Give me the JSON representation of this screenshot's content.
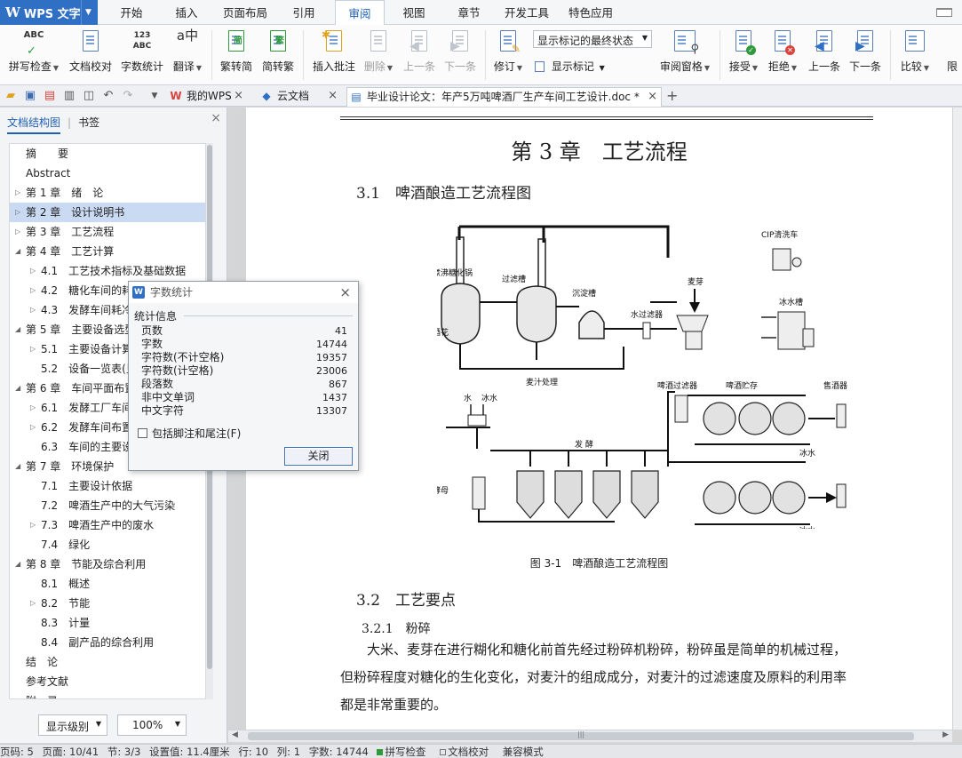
{
  "app": {
    "name": "WPS 文字"
  },
  "menu": [
    "开始",
    "插入",
    "页面布局",
    "引用",
    "审阅",
    "视图",
    "章节",
    "开发工具",
    "特色应用"
  ],
  "menu_active": "审阅",
  "ribbon": {
    "spell": "拼写检查",
    "proofread": "文档校对",
    "wordcount": "字数统计",
    "translate": "翻译",
    "trad2simp": "繁转简",
    "simp2trad": "简转繁",
    "insert_comment": "插入批注",
    "delete": "删除",
    "prev": "上一条",
    "next": "下一条",
    "revise": "修订",
    "track_state": "显示标记的最终状态",
    "show_marks": "显示标记",
    "review_pane": "审阅窗格",
    "accept": "接受",
    "reject": "拒绝",
    "prev2": "上一条",
    "next2": "下一条",
    "compare": "比较",
    "restrict": "限"
  },
  "tabs": {
    "mywps": "我的WPS",
    "cloud": "云文档",
    "doc": "毕业设计论文：年产5万吨啤酒厂生产车间工艺设计.doc *"
  },
  "panel": {
    "tab_outline": "文档结构图",
    "tab_bookmark": "书签",
    "level_select": "显示级别",
    "zoom_select": "100%"
  },
  "outline": [
    {
      "text": "摘　　要",
      "level": 0,
      "arrow": ""
    },
    {
      "text": "Abstract",
      "level": 0,
      "arrow": ""
    },
    {
      "text": "第 1 章　绪　论",
      "level": 0,
      "arrow": "▷"
    },
    {
      "text": "第 2 章　设计说明书",
      "level": 0,
      "arrow": "▷",
      "selected": true
    },
    {
      "text": "第 3 章　工艺流程",
      "level": 0,
      "arrow": "▷"
    },
    {
      "text": "第 4 章　工艺计算",
      "level": 0,
      "arrow": "◢"
    },
    {
      "text": "4.1　工艺技术指标及基础数据",
      "level": 1,
      "arrow": "▷"
    },
    {
      "text": "4.2　糖化车间的耗热量计算",
      "level": 1,
      "arrow": "▷"
    },
    {
      "text": "4.3　发酵车间耗冷量计算",
      "level": 1,
      "arrow": "▷"
    },
    {
      "text": "第 5 章　主要设备选型",
      "level": 0,
      "arrow": "◢"
    },
    {
      "text": "5.1　主要设备计算",
      "level": 1,
      "arrow": "▷"
    },
    {
      "text": "5.2　设备一览表(见附录)",
      "level": 1,
      "arrow": ""
    },
    {
      "text": "第 6 章　车间平面布置",
      "level": 0,
      "arrow": "◢"
    },
    {
      "text": "6.1　发酵工厂车间布置",
      "level": 1,
      "arrow": "▷"
    },
    {
      "text": "6.2　发酵车间布置",
      "level": 1,
      "arrow": "▷"
    },
    {
      "text": "6.3　车间的主要设备",
      "level": 1,
      "arrow": ""
    },
    {
      "text": "第 7 章　环境保护",
      "level": 0,
      "arrow": "◢"
    },
    {
      "text": "7.1　主要设计依据",
      "level": 1,
      "arrow": ""
    },
    {
      "text": "7.2　啤酒生产中的大气污染",
      "level": 1,
      "arrow": ""
    },
    {
      "text": "7.3　啤酒生产中的废水",
      "level": 1,
      "arrow": "▷"
    },
    {
      "text": "7.4　绿化",
      "level": 1,
      "arrow": ""
    },
    {
      "text": "第 8 章　节能及综合利用",
      "level": 0,
      "arrow": "◢"
    },
    {
      "text": "8.1　概述",
      "level": 1,
      "arrow": ""
    },
    {
      "text": "8.2　节能",
      "level": 1,
      "arrow": "▷"
    },
    {
      "text": "8.3　计量",
      "level": 1,
      "arrow": ""
    },
    {
      "text": "8.4　副产品的综合利用",
      "level": 1,
      "arrow": ""
    },
    {
      "text": "结　论",
      "level": 0,
      "arrow": ""
    },
    {
      "text": "参考文献",
      "level": 0,
      "arrow": ""
    },
    {
      "text": "附　录",
      "level": 0,
      "arrow": ""
    }
  ],
  "document": {
    "chapter_title": "第 3 章　工艺流程",
    "s31": "3.1　啤酒酿造工艺流程图",
    "figure_caption": "图 3-1　啤酒酿造工艺流程图",
    "s32": "3.2　工艺要点",
    "s321": "3.2.1　粉碎",
    "para1_line1": "大米、麦芽在进行糊化和糖化前首先经过粉碎机粉碎，粉碎虽是简单的机械过程，",
    "para1_line2": "但粉碎程度对糖化的生化变化，对麦汁的组成成分，对麦汁的过滤速度及原料的利用率",
    "para1_line3": "都是非常重要的。"
  },
  "figure_labels": {
    "cip": "CIP清洗车",
    "boil": "煮沸糖化锅",
    "lauter": "过滤槽",
    "whirl": "沉淀槽",
    "malt": "麦芽",
    "hops": "酒花",
    "water_filter": "水过滤器",
    "ice_tank": "冰水槽",
    "wort": "麦汁处理",
    "water": "水",
    "ice_water": "冰水",
    "beer_filter": "啤酒过滤器",
    "beer_storage": "啤酒贮存",
    "sell": "售酒器",
    "ferment": "发 酵",
    "yeast": "酵母",
    "ice_water2": "冰水",
    "ice_water3": "冰水"
  },
  "dialog": {
    "title": "字数统计",
    "group": "统计信息",
    "stats": [
      {
        "label": "页数",
        "value": "41"
      },
      {
        "label": "字数",
        "value": "14744"
      },
      {
        "label": "字符数(不计空格)",
        "value": "19357"
      },
      {
        "label": "字符数(计空格)",
        "value": "23006"
      },
      {
        "label": "段落数",
        "value": "867"
      },
      {
        "label": "非中文单词",
        "value": "1437"
      },
      {
        "label": "中文字符",
        "value": "13307"
      }
    ],
    "include_footnotes": "包括脚注和尾注(F)",
    "close_btn": "关闭"
  },
  "status": {
    "page_num": "页码: 5",
    "page": "页面: 10/41",
    "section": "节: 3/3",
    "setting": "设置值: 11.4厘米",
    "row": "行: 10",
    "col": "列: 1",
    "words": "字数: 14744",
    "spell": "拼写检查",
    "proof": "文档校对",
    "compat": "兼容模式"
  }
}
